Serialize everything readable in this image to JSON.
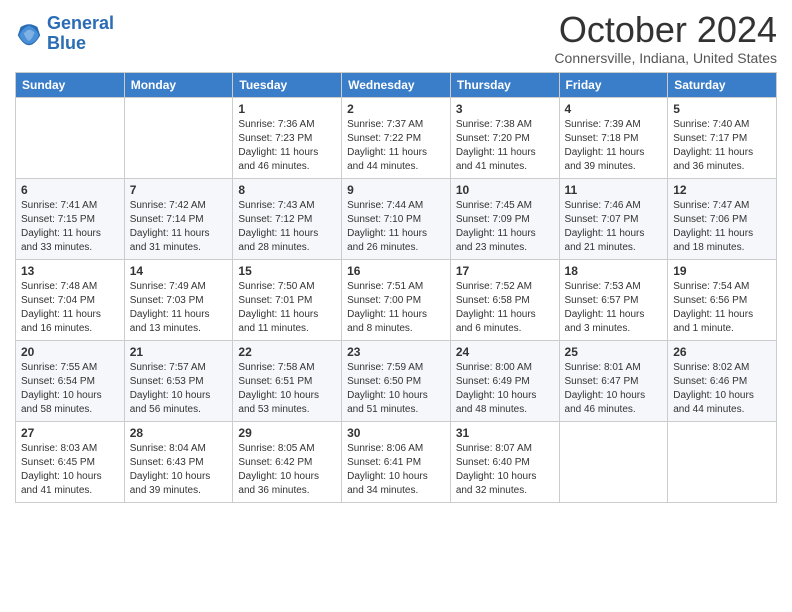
{
  "logo": {
    "line1": "General",
    "line2": "Blue"
  },
  "title": "October 2024",
  "location": "Connersville, Indiana, United States",
  "days_of_week": [
    "Sunday",
    "Monday",
    "Tuesday",
    "Wednesday",
    "Thursday",
    "Friday",
    "Saturday"
  ],
  "weeks": [
    [
      null,
      null,
      {
        "day": 1,
        "sunrise": "Sunrise: 7:36 AM",
        "sunset": "Sunset: 7:23 PM",
        "daylight": "Daylight: 11 hours and 46 minutes."
      },
      {
        "day": 2,
        "sunrise": "Sunrise: 7:37 AM",
        "sunset": "Sunset: 7:22 PM",
        "daylight": "Daylight: 11 hours and 44 minutes."
      },
      {
        "day": 3,
        "sunrise": "Sunrise: 7:38 AM",
        "sunset": "Sunset: 7:20 PM",
        "daylight": "Daylight: 11 hours and 41 minutes."
      },
      {
        "day": 4,
        "sunrise": "Sunrise: 7:39 AM",
        "sunset": "Sunset: 7:18 PM",
        "daylight": "Daylight: 11 hours and 39 minutes."
      },
      {
        "day": 5,
        "sunrise": "Sunrise: 7:40 AM",
        "sunset": "Sunset: 7:17 PM",
        "daylight": "Daylight: 11 hours and 36 minutes."
      }
    ],
    [
      {
        "day": 6,
        "sunrise": "Sunrise: 7:41 AM",
        "sunset": "Sunset: 7:15 PM",
        "daylight": "Daylight: 11 hours and 33 minutes."
      },
      {
        "day": 7,
        "sunrise": "Sunrise: 7:42 AM",
        "sunset": "Sunset: 7:14 PM",
        "daylight": "Daylight: 11 hours and 31 minutes."
      },
      {
        "day": 8,
        "sunrise": "Sunrise: 7:43 AM",
        "sunset": "Sunset: 7:12 PM",
        "daylight": "Daylight: 11 hours and 28 minutes."
      },
      {
        "day": 9,
        "sunrise": "Sunrise: 7:44 AM",
        "sunset": "Sunset: 7:10 PM",
        "daylight": "Daylight: 11 hours and 26 minutes."
      },
      {
        "day": 10,
        "sunrise": "Sunrise: 7:45 AM",
        "sunset": "Sunset: 7:09 PM",
        "daylight": "Daylight: 11 hours and 23 minutes."
      },
      {
        "day": 11,
        "sunrise": "Sunrise: 7:46 AM",
        "sunset": "Sunset: 7:07 PM",
        "daylight": "Daylight: 11 hours and 21 minutes."
      },
      {
        "day": 12,
        "sunrise": "Sunrise: 7:47 AM",
        "sunset": "Sunset: 7:06 PM",
        "daylight": "Daylight: 11 hours and 18 minutes."
      }
    ],
    [
      {
        "day": 13,
        "sunrise": "Sunrise: 7:48 AM",
        "sunset": "Sunset: 7:04 PM",
        "daylight": "Daylight: 11 hours and 16 minutes."
      },
      {
        "day": 14,
        "sunrise": "Sunrise: 7:49 AM",
        "sunset": "Sunset: 7:03 PM",
        "daylight": "Daylight: 11 hours and 13 minutes."
      },
      {
        "day": 15,
        "sunrise": "Sunrise: 7:50 AM",
        "sunset": "Sunset: 7:01 PM",
        "daylight": "Daylight: 11 hours and 11 minutes."
      },
      {
        "day": 16,
        "sunrise": "Sunrise: 7:51 AM",
        "sunset": "Sunset: 7:00 PM",
        "daylight": "Daylight: 11 hours and 8 minutes."
      },
      {
        "day": 17,
        "sunrise": "Sunrise: 7:52 AM",
        "sunset": "Sunset: 6:58 PM",
        "daylight": "Daylight: 11 hours and 6 minutes."
      },
      {
        "day": 18,
        "sunrise": "Sunrise: 7:53 AM",
        "sunset": "Sunset: 6:57 PM",
        "daylight": "Daylight: 11 hours and 3 minutes."
      },
      {
        "day": 19,
        "sunrise": "Sunrise: 7:54 AM",
        "sunset": "Sunset: 6:56 PM",
        "daylight": "Daylight: 11 hours and 1 minute."
      }
    ],
    [
      {
        "day": 20,
        "sunrise": "Sunrise: 7:55 AM",
        "sunset": "Sunset: 6:54 PM",
        "daylight": "Daylight: 10 hours and 58 minutes."
      },
      {
        "day": 21,
        "sunrise": "Sunrise: 7:57 AM",
        "sunset": "Sunset: 6:53 PM",
        "daylight": "Daylight: 10 hours and 56 minutes."
      },
      {
        "day": 22,
        "sunrise": "Sunrise: 7:58 AM",
        "sunset": "Sunset: 6:51 PM",
        "daylight": "Daylight: 10 hours and 53 minutes."
      },
      {
        "day": 23,
        "sunrise": "Sunrise: 7:59 AM",
        "sunset": "Sunset: 6:50 PM",
        "daylight": "Daylight: 10 hours and 51 minutes."
      },
      {
        "day": 24,
        "sunrise": "Sunrise: 8:00 AM",
        "sunset": "Sunset: 6:49 PM",
        "daylight": "Daylight: 10 hours and 48 minutes."
      },
      {
        "day": 25,
        "sunrise": "Sunrise: 8:01 AM",
        "sunset": "Sunset: 6:47 PM",
        "daylight": "Daylight: 10 hours and 46 minutes."
      },
      {
        "day": 26,
        "sunrise": "Sunrise: 8:02 AM",
        "sunset": "Sunset: 6:46 PM",
        "daylight": "Daylight: 10 hours and 44 minutes."
      }
    ],
    [
      {
        "day": 27,
        "sunrise": "Sunrise: 8:03 AM",
        "sunset": "Sunset: 6:45 PM",
        "daylight": "Daylight: 10 hours and 41 minutes."
      },
      {
        "day": 28,
        "sunrise": "Sunrise: 8:04 AM",
        "sunset": "Sunset: 6:43 PM",
        "daylight": "Daylight: 10 hours and 39 minutes."
      },
      {
        "day": 29,
        "sunrise": "Sunrise: 8:05 AM",
        "sunset": "Sunset: 6:42 PM",
        "daylight": "Daylight: 10 hours and 36 minutes."
      },
      {
        "day": 30,
        "sunrise": "Sunrise: 8:06 AM",
        "sunset": "Sunset: 6:41 PM",
        "daylight": "Daylight: 10 hours and 34 minutes."
      },
      {
        "day": 31,
        "sunrise": "Sunrise: 8:07 AM",
        "sunset": "Sunset: 6:40 PM",
        "daylight": "Daylight: 10 hours and 32 minutes."
      },
      null,
      null
    ]
  ]
}
